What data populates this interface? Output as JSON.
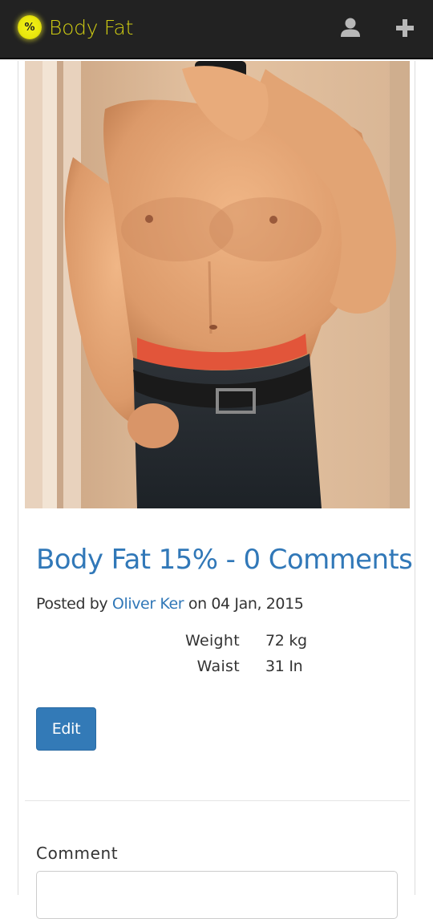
{
  "navbar": {
    "brand_symbol": "%",
    "brand_name": "Body Fat",
    "brand_color": "#cfcc12",
    "icons": [
      "user-icon",
      "plus-icon"
    ]
  },
  "post": {
    "title": "Body Fat 15% - 0 Comments",
    "byline_prefix": "Posted by ",
    "author": "Oliver Ker",
    "byline_middle": " on ",
    "date": "04 Jan, 2015",
    "stats": [
      {
        "label": "Weight",
        "value": "72 kg"
      },
      {
        "label": "Waist",
        "value": "31 In"
      }
    ],
    "edit_label": "Edit"
  },
  "comment": {
    "label": "Comment",
    "value": ""
  },
  "colors": {
    "navbar_bg": "#222222",
    "link": "#3178b8",
    "button": "#337ab7"
  }
}
